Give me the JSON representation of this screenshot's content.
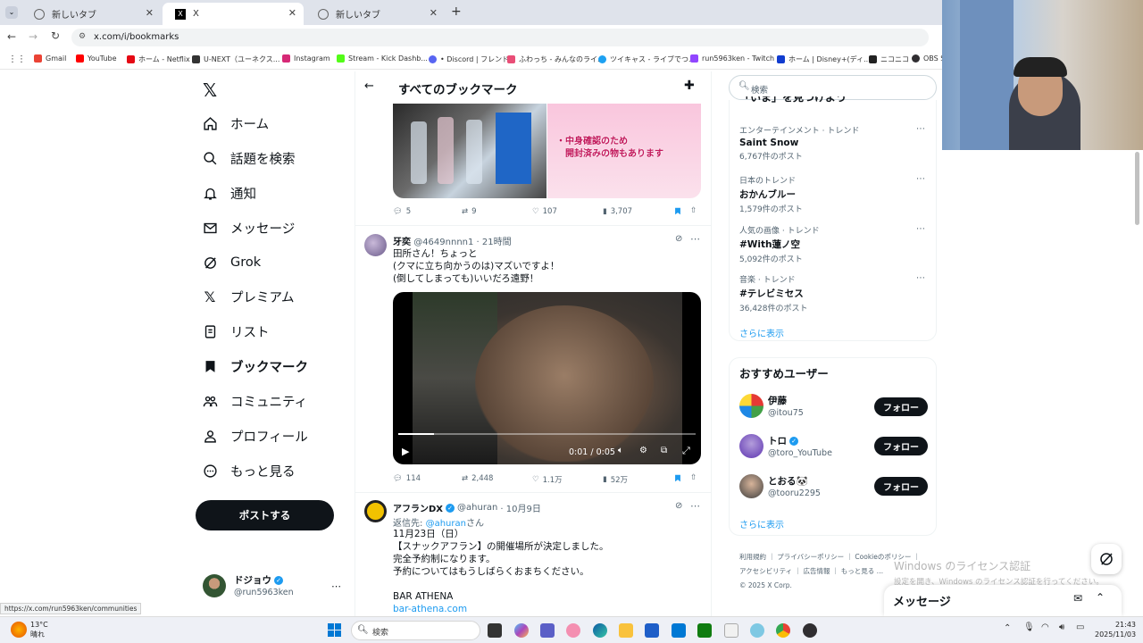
{
  "browser": {
    "tabs": [
      {
        "label": "新しいタブ"
      },
      {
        "label": "X"
      },
      {
        "label": "新しいタブ"
      }
    ],
    "url": "x.com/i/bookmarks",
    "bookmarks": [
      "Gmail",
      "YouTube",
      "ホーム - Netflix",
      "U-NEXT（ユーネクス...",
      "Instagram",
      "Stream - Kick Dashb...",
      "• Discord | フレンド",
      "ふわっち - みんなのライ...",
      "ツイキャス - ライブでつ...",
      "run5963ken - Twitch",
      "ホーム | Disney+(ディ...",
      "ニコニコ",
      "OBS S"
    ],
    "status_url": "https://x.com/run5963ken/communities"
  },
  "nav": {
    "items": [
      {
        "label": "ホーム"
      },
      {
        "label": "話題を検索"
      },
      {
        "label": "通知"
      },
      {
        "label": "メッセージ"
      },
      {
        "label": "Grok"
      },
      {
        "label": "プレミアム"
      },
      {
        "label": "リスト"
      },
      {
        "label": "ブックマーク"
      },
      {
        "label": "コミュニティ"
      },
      {
        "label": "プロフィール"
      },
      {
        "label": "もっと見る"
      }
    ],
    "post_button": "ポストする",
    "account": {
      "name": "ドジョウ",
      "handle": "@run5963ken"
    }
  },
  "header": {
    "title": "すべてのブックマーク"
  },
  "tweet1": {
    "image_text": [
      "・中身確認のため",
      "開封済みの物もあります"
    ],
    "replies": "5",
    "reposts": "9",
    "likes": "107",
    "views": "3,707"
  },
  "tweet2": {
    "name": "牙奕",
    "handle": "@4649nnnn1",
    "time": "· 21時間",
    "lines": [
      "田所さん！ちょっと",
      "(クマに立ち向かうのは)マズいですよ！",
      "(倒してしまっても)いいだろ遠野！"
    ],
    "video_time": "0:01 / 0:05",
    "replies": "114",
    "reposts": "2,448",
    "likes": "1.1万",
    "views": "52万"
  },
  "tweet3": {
    "name": "アフランDX",
    "handle": "@ahuran",
    "time": "· 10月9日",
    "reply_prefix": "返信先:",
    "reply_to": "@ahuran",
    "reply_suffix": "さん",
    "lines": [
      "11月23日（日）",
      "【スナックアフラン】の開催場所が決定しました。",
      "完全予約制になります。",
      "予約についてはもうしばらくおまちください。"
    ],
    "bar": "BAR ATHENA",
    "bar_link": "bar-athena.com"
  },
  "search": {
    "placeholder": "検索"
  },
  "trends": {
    "header_partial": "「いま」を見つけよう",
    "items": [
      {
        "meta": "エンターテインメント · トレンド",
        "name": "Saint Snow",
        "count": "6,767件のポスト"
      },
      {
        "meta": "日本のトレンド",
        "name": "おかんブルー",
        "count": "1,579件のポスト"
      },
      {
        "meta": "人気の画像 · トレンド",
        "name": "#With蓮ノ空",
        "count": "5,092件のポスト"
      },
      {
        "meta": "音楽 · トレンド",
        "name": "#テレビミセス",
        "count": "36,428件のポスト"
      }
    ],
    "show_more": "さらに表示"
  },
  "who_to_follow": {
    "title": "おすすめユーザー",
    "users": [
      {
        "name": "伊藤",
        "handle": "@itou75"
      },
      {
        "name": "トロ",
        "handle": "@toro_YouTube"
      },
      {
        "name": "とおる🐼",
        "handle": "@tooru2295"
      }
    ],
    "follow_label": "フォロー",
    "show_more": "さらに表示"
  },
  "footer": {
    "links": [
      "利用規約",
      "プライバシーポリシー",
      "Cookieのポリシー",
      "アクセシビリティ",
      "広告情報",
      "もっと見る …"
    ],
    "copyright": "© 2025 X Corp."
  },
  "windows_watermark": {
    "title": "Windows のライセンス認証",
    "sub": "設定を開き、Windows のライセンス認証を行ってください。"
  },
  "messages_drawer": {
    "title": "メッセージ"
  },
  "taskbar": {
    "weather_temp": "13°C",
    "weather_desc": "晴れ",
    "search_placeholder": "検索",
    "time": "21:43",
    "date": "2025/11/03"
  },
  "colors": {
    "accent": "#1d9bf0",
    "text": "#0f1419",
    "muted": "#536471"
  }
}
